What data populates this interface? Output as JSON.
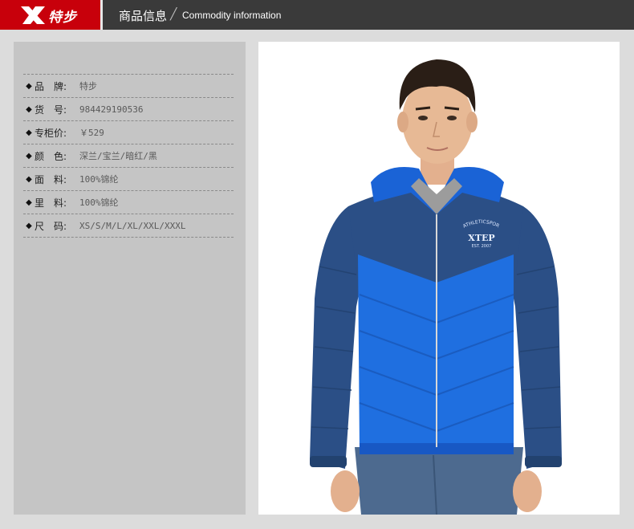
{
  "header": {
    "brand": "特步",
    "title": "商品信息",
    "slash": "╱",
    "subtitle": "Commodity information"
  },
  "product_info": [
    {
      "label": "品　牌:",
      "value": "特步"
    },
    {
      "label": "货　号:",
      "value": "984429190536"
    },
    {
      "label": "专柜价:",
      "value": "￥529"
    },
    {
      "label": "颜　色:",
      "value": "深兰/宝兰/暗红/黑"
    },
    {
      "label": "面　料:",
      "value": "100%锦纶"
    },
    {
      "label": "里　料:",
      "value": "100%锦纶"
    },
    {
      "label": "尺　码:",
      "value": "XS/S/M/L/XL/XXL/XXXL"
    }
  ],
  "jacket_print": {
    "arc_text": "ATHLETICSPORTS",
    "brand": "XTEP",
    "est": "EST. 2007"
  },
  "colors": {
    "brand_red": "#c8000b",
    "header_dark": "#3a3a3a",
    "jacket_navy": "#2b4f86",
    "jacket_royal": "#1f6fe0"
  }
}
